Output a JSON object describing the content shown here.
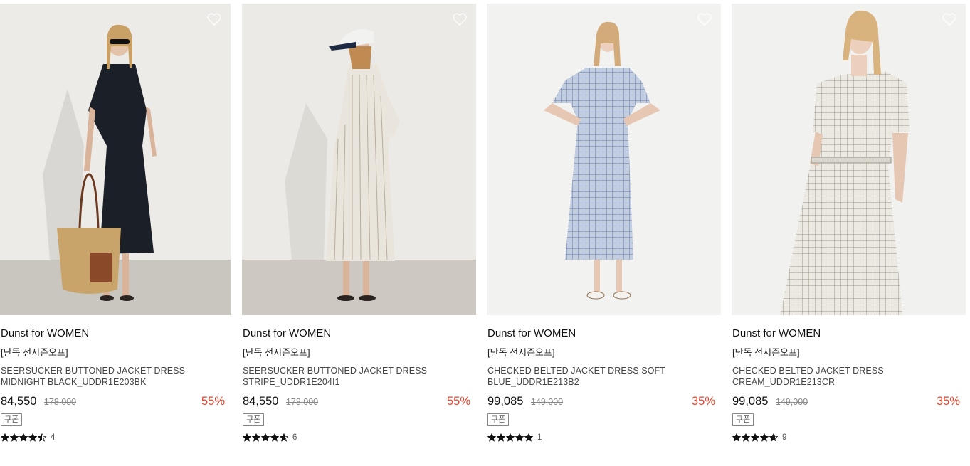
{
  "products": [
    {
      "brand": "Dunst for WOMEN",
      "tag": "[단독 선시즌오프]",
      "name": "SEERSUCKER BUTTONED JACKET DRESS MIDNIGHT BLACK_UDDR1E203BK",
      "price": "84,550",
      "original_price": "178,000",
      "discount": "55%",
      "coupon": "쿠폰",
      "rating": 4.5,
      "review_count": "4",
      "image": "dress-black-photo"
    },
    {
      "brand": "Dunst for WOMEN",
      "tag": "[단독 선시즌오프]",
      "name": "SEERSUCKER BUTTONED JACKET DRESS STRIPE_UDDR1E204I1",
      "price": "84,550",
      "original_price": "178,000",
      "discount": "55%",
      "coupon": "쿠폰",
      "rating": 4.7,
      "review_count": "6",
      "image": "dress-stripe-photo"
    },
    {
      "brand": "Dunst for WOMEN",
      "tag": "[단독 선시즌오프]",
      "name": "CHECKED BELTED JACKET DRESS SOFT BLUE_UDDR1E213B2",
      "price": "99,085",
      "original_price": "149,000",
      "discount": "35%",
      "coupon": "쿠폰",
      "rating": 5,
      "review_count": "1",
      "image": "dress-blue-check-photo"
    },
    {
      "brand": "Dunst for WOMEN",
      "tag": "[단독 선시즌오프]",
      "name": "CHECKED BELTED JACKET DRESS CREAM_UDDR1E213CR",
      "price": "99,085",
      "original_price": "149,000",
      "discount": "35%",
      "coupon": "쿠폰",
      "rating": 4.7,
      "review_count": "9",
      "image": "dress-cream-check-photo"
    }
  ],
  "colors": {
    "discount": "#e8442e",
    "text": "#111111",
    "muted": "#888888"
  },
  "icons": {
    "wishlist": "heart-icon",
    "rating": "star-icon"
  }
}
